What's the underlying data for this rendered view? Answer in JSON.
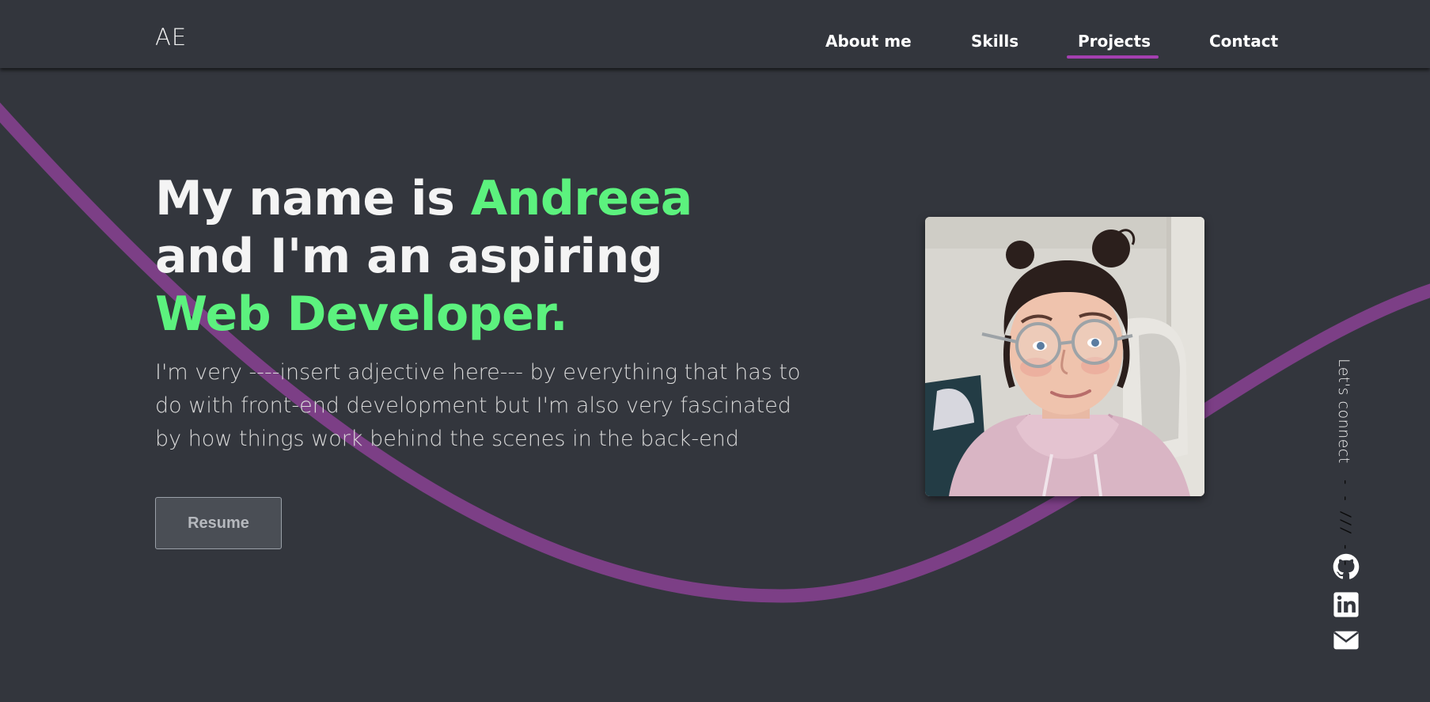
{
  "header": {
    "logo": "AE",
    "nav": [
      {
        "label": "About me"
      },
      {
        "label": "Skills"
      },
      {
        "label": "Projects",
        "active": true
      },
      {
        "label": "Contact"
      }
    ]
  },
  "hero": {
    "title_part1": "My name is ",
    "title_name": "Andreea",
    "title_line2": "and I'm an aspiring",
    "title_role": "Web Developer.",
    "description": "I'm very ----insert adjective here--- by everything that has to do with front-end development but I'm also very fascinated by how things work behind the scenes in the back-end",
    "resume_label": "Resume"
  },
  "side": {
    "connect_label": "Let's connect",
    "divider": "- - /// - -",
    "icons": [
      "github-icon",
      "linkedin-icon",
      "mail-icon"
    ]
  },
  "colors": {
    "background": "#33363d",
    "accent_green": "#5cf27e",
    "accent_purple": "#a43fb0",
    "text": "#ffffff"
  }
}
